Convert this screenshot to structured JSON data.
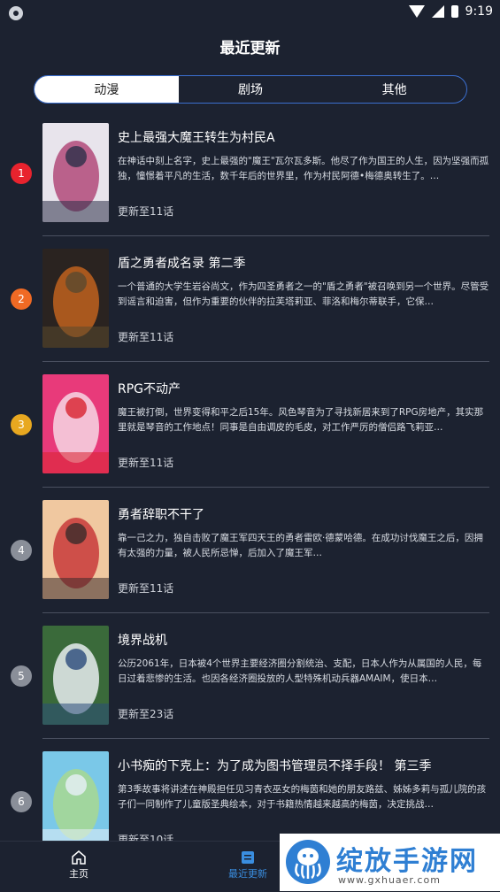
{
  "status": {
    "time": "9:19"
  },
  "header": {
    "title": "最近更新"
  },
  "tabs": [
    {
      "label": "动漫",
      "active": true
    },
    {
      "label": "剧场",
      "active": false
    },
    {
      "label": "其他",
      "active": false
    }
  ],
  "items": [
    {
      "rank": "1",
      "rank_color": "#e8232e",
      "title": "史上最强大魔王转生为村民A",
      "desc": "在神话中刻上名字，史上最强的\"魔王\"瓦尔瓦多斯。他尽了作为国王的人生，因为坚强而孤独，憧憬着平凡的生活，数千年后的世界里，作为村民阿德•梅德奥转生了。…",
      "update": "更新至11话",
      "cover_colors": [
        "#e8e4ec",
        "#b14a7a",
        "#2c2f48"
      ]
    },
    {
      "rank": "2",
      "rank_color": "#f06a24",
      "title": "盾之勇者成名录 第二季",
      "desc": "一个普通的大学生岩谷尚文，作为四圣勇者之一的\"盾之勇者\"被召唤到另一个世界。尽管受到谣言和迫害，但作为重要的伙伴的拉芙塔莉亚、菲洛和梅尔蒂联手，它保…",
      "update": "更新至11话",
      "cover_colors": [
        "#2a2320",
        "#c0621e",
        "#5a4a2e"
      ]
    },
    {
      "rank": "3",
      "rank_color": "#e8a820",
      "title": "RPG不动产",
      "desc": "魔王被打倒，世界变得和平之后15年。风色琴音为了寻找新居来到了RPG房地产，其实那里就是琴音的工作地点！同事是自由调皮的毛皮，对工作严厉的僧侣路飞莉亚…",
      "update": "更新至11话",
      "cover_colors": [
        "#e83a7a",
        "#f6d7e4",
        "#d8232e"
      ]
    },
    {
      "rank": "4",
      "rank_color": "#8a8f99",
      "title": "勇者辞职不干了",
      "desc": "靠一己之力，独自击败了魔王军四天王的勇者雷欧·德蒙哈德。在成功讨伐魔王之后，因拥有太强的力量，被人民所忌惮，后加入了魔王军…",
      "update": "更新至11话",
      "cover_colors": [
        "#f0c8a0",
        "#c83a3a",
        "#3a2a2a"
      ]
    },
    {
      "rank": "5",
      "rank_color": "#8a8f99",
      "title": "境界战机",
      "desc": "公历2061年，日本被4个世界主要经济圈分割统治、支配，日本人作为从属国的人民，每日过着悲惨的生活。也因各经济圈投放的人型特殊机动兵器AMAIM，使日本…",
      "update": "更新至23话",
      "cover_colors": [
        "#3a6a3a",
        "#e8ecf0",
        "#2a4a7a"
      ]
    },
    {
      "rank": "6",
      "rank_color": "#8a8f99",
      "title": "小书痴的下克上：为了成为图书管理员不择手段！ 第三季",
      "desc": "第3季故事将讲述在神殿担任见习青衣巫女的梅茵和她的朋友路兹、姊姊多莉与孤儿院的孩子们一同制作了儿童版圣典绘本，对于书籍热情越来越高的梅茵，决定挑战…",
      "update": "更新至10话",
      "cover_colors": [
        "#7ac8e8",
        "#a8d890",
        "#e8f0f8"
      ]
    }
  ],
  "bottom_nav": [
    {
      "label": "主页",
      "icon": "home-icon",
      "active": false
    },
    {
      "label": "最近更新",
      "icon": "update-icon",
      "active": true
    }
  ],
  "watermark": {
    "text": "绽放手游网",
    "url": "www.gxhuaer.com"
  }
}
